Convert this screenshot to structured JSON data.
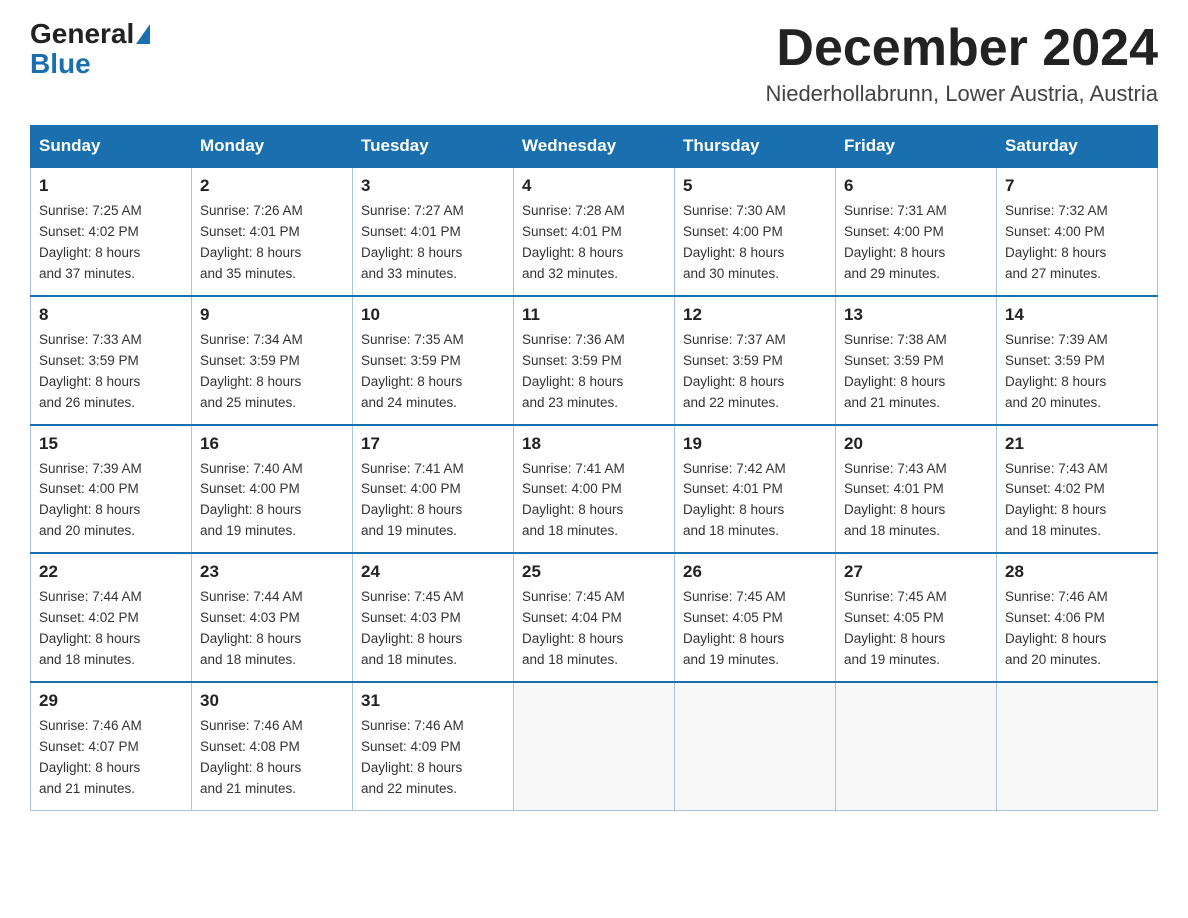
{
  "header": {
    "logo_general": "General",
    "logo_blue": "Blue",
    "month_title": "December 2024",
    "location": "Niederhollabrunn, Lower Austria, Austria"
  },
  "weekdays": [
    "Sunday",
    "Monday",
    "Tuesday",
    "Wednesday",
    "Thursday",
    "Friday",
    "Saturday"
  ],
  "weeks": [
    [
      {
        "day": "1",
        "sunrise": "7:25 AM",
        "sunset": "4:02 PM",
        "daylight": "8 hours and 37 minutes."
      },
      {
        "day": "2",
        "sunrise": "7:26 AM",
        "sunset": "4:01 PM",
        "daylight": "8 hours and 35 minutes."
      },
      {
        "day": "3",
        "sunrise": "7:27 AM",
        "sunset": "4:01 PM",
        "daylight": "8 hours and 33 minutes."
      },
      {
        "day": "4",
        "sunrise": "7:28 AM",
        "sunset": "4:01 PM",
        "daylight": "8 hours and 32 minutes."
      },
      {
        "day": "5",
        "sunrise": "7:30 AM",
        "sunset": "4:00 PM",
        "daylight": "8 hours and 30 minutes."
      },
      {
        "day": "6",
        "sunrise": "7:31 AM",
        "sunset": "4:00 PM",
        "daylight": "8 hours and 29 minutes."
      },
      {
        "day": "7",
        "sunrise": "7:32 AM",
        "sunset": "4:00 PM",
        "daylight": "8 hours and 27 minutes."
      }
    ],
    [
      {
        "day": "8",
        "sunrise": "7:33 AM",
        "sunset": "3:59 PM",
        "daylight": "8 hours and 26 minutes."
      },
      {
        "day": "9",
        "sunrise": "7:34 AM",
        "sunset": "3:59 PM",
        "daylight": "8 hours and 25 minutes."
      },
      {
        "day": "10",
        "sunrise": "7:35 AM",
        "sunset": "3:59 PM",
        "daylight": "8 hours and 24 minutes."
      },
      {
        "day": "11",
        "sunrise": "7:36 AM",
        "sunset": "3:59 PM",
        "daylight": "8 hours and 23 minutes."
      },
      {
        "day": "12",
        "sunrise": "7:37 AM",
        "sunset": "3:59 PM",
        "daylight": "8 hours and 22 minutes."
      },
      {
        "day": "13",
        "sunrise": "7:38 AM",
        "sunset": "3:59 PM",
        "daylight": "8 hours and 21 minutes."
      },
      {
        "day": "14",
        "sunrise": "7:39 AM",
        "sunset": "3:59 PM",
        "daylight": "8 hours and 20 minutes."
      }
    ],
    [
      {
        "day": "15",
        "sunrise": "7:39 AM",
        "sunset": "4:00 PM",
        "daylight": "8 hours and 20 minutes."
      },
      {
        "day": "16",
        "sunrise": "7:40 AM",
        "sunset": "4:00 PM",
        "daylight": "8 hours and 19 minutes."
      },
      {
        "day": "17",
        "sunrise": "7:41 AM",
        "sunset": "4:00 PM",
        "daylight": "8 hours and 19 minutes."
      },
      {
        "day": "18",
        "sunrise": "7:41 AM",
        "sunset": "4:00 PM",
        "daylight": "8 hours and 18 minutes."
      },
      {
        "day": "19",
        "sunrise": "7:42 AM",
        "sunset": "4:01 PM",
        "daylight": "8 hours and 18 minutes."
      },
      {
        "day": "20",
        "sunrise": "7:43 AM",
        "sunset": "4:01 PM",
        "daylight": "8 hours and 18 minutes."
      },
      {
        "day": "21",
        "sunrise": "7:43 AM",
        "sunset": "4:02 PM",
        "daylight": "8 hours and 18 minutes."
      }
    ],
    [
      {
        "day": "22",
        "sunrise": "7:44 AM",
        "sunset": "4:02 PM",
        "daylight": "8 hours and 18 minutes."
      },
      {
        "day": "23",
        "sunrise": "7:44 AM",
        "sunset": "4:03 PM",
        "daylight": "8 hours and 18 minutes."
      },
      {
        "day": "24",
        "sunrise": "7:45 AM",
        "sunset": "4:03 PM",
        "daylight": "8 hours and 18 minutes."
      },
      {
        "day": "25",
        "sunrise": "7:45 AM",
        "sunset": "4:04 PM",
        "daylight": "8 hours and 18 minutes."
      },
      {
        "day": "26",
        "sunrise": "7:45 AM",
        "sunset": "4:05 PM",
        "daylight": "8 hours and 19 minutes."
      },
      {
        "day": "27",
        "sunrise": "7:45 AM",
        "sunset": "4:05 PM",
        "daylight": "8 hours and 19 minutes."
      },
      {
        "day": "28",
        "sunrise": "7:46 AM",
        "sunset": "4:06 PM",
        "daylight": "8 hours and 20 minutes."
      }
    ],
    [
      {
        "day": "29",
        "sunrise": "7:46 AM",
        "sunset": "4:07 PM",
        "daylight": "8 hours and 21 minutes."
      },
      {
        "day": "30",
        "sunrise": "7:46 AM",
        "sunset": "4:08 PM",
        "daylight": "8 hours and 21 minutes."
      },
      {
        "day": "31",
        "sunrise": "7:46 AM",
        "sunset": "4:09 PM",
        "daylight": "8 hours and 22 minutes."
      },
      null,
      null,
      null,
      null
    ]
  ]
}
